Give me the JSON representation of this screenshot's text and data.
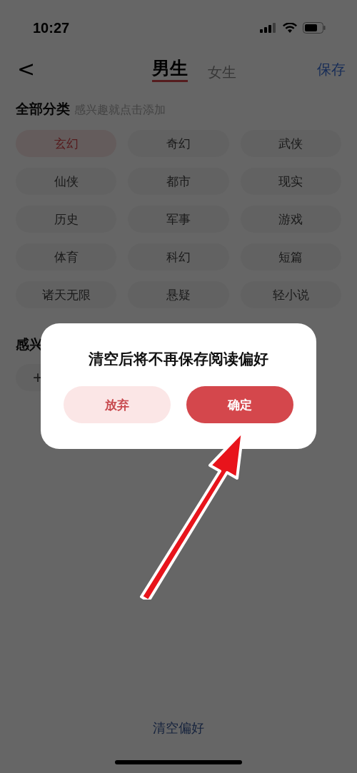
{
  "status_bar": {
    "time": "10:27"
  },
  "nav": {
    "back": "<",
    "tabs": [
      {
        "label": "男生",
        "selected": true
      },
      {
        "label": "女生",
        "selected": false
      }
    ],
    "save": "保存"
  },
  "all_categories": {
    "title": "全部分类",
    "hint": "感兴趣就点击添加",
    "items": [
      {
        "label": "玄幻",
        "selected": true
      },
      {
        "label": "奇幻",
        "selected": false
      },
      {
        "label": "武侠",
        "selected": false
      },
      {
        "label": "仙侠",
        "selected": false
      },
      {
        "label": "都市",
        "selected": false
      },
      {
        "label": "现实",
        "selected": false
      },
      {
        "label": "历史",
        "selected": false
      },
      {
        "label": "军事",
        "selected": false
      },
      {
        "label": "游戏",
        "selected": false
      },
      {
        "label": "体育",
        "selected": false
      },
      {
        "label": "科幻",
        "selected": false
      },
      {
        "label": "短篇",
        "selected": false
      },
      {
        "label": "诸天无限",
        "selected": false
      },
      {
        "label": "悬疑",
        "selected": false
      },
      {
        "label": "轻小说",
        "selected": false
      }
    ]
  },
  "interests": {
    "title": "感兴",
    "add": "+"
  },
  "clear_button": "清空偏好",
  "dialog": {
    "message": "清空后将不再保存阅读偏好",
    "buttons": [
      {
        "label": "放弃",
        "kind": "secondary"
      },
      {
        "label": "确定",
        "kind": "primary"
      }
    ]
  }
}
